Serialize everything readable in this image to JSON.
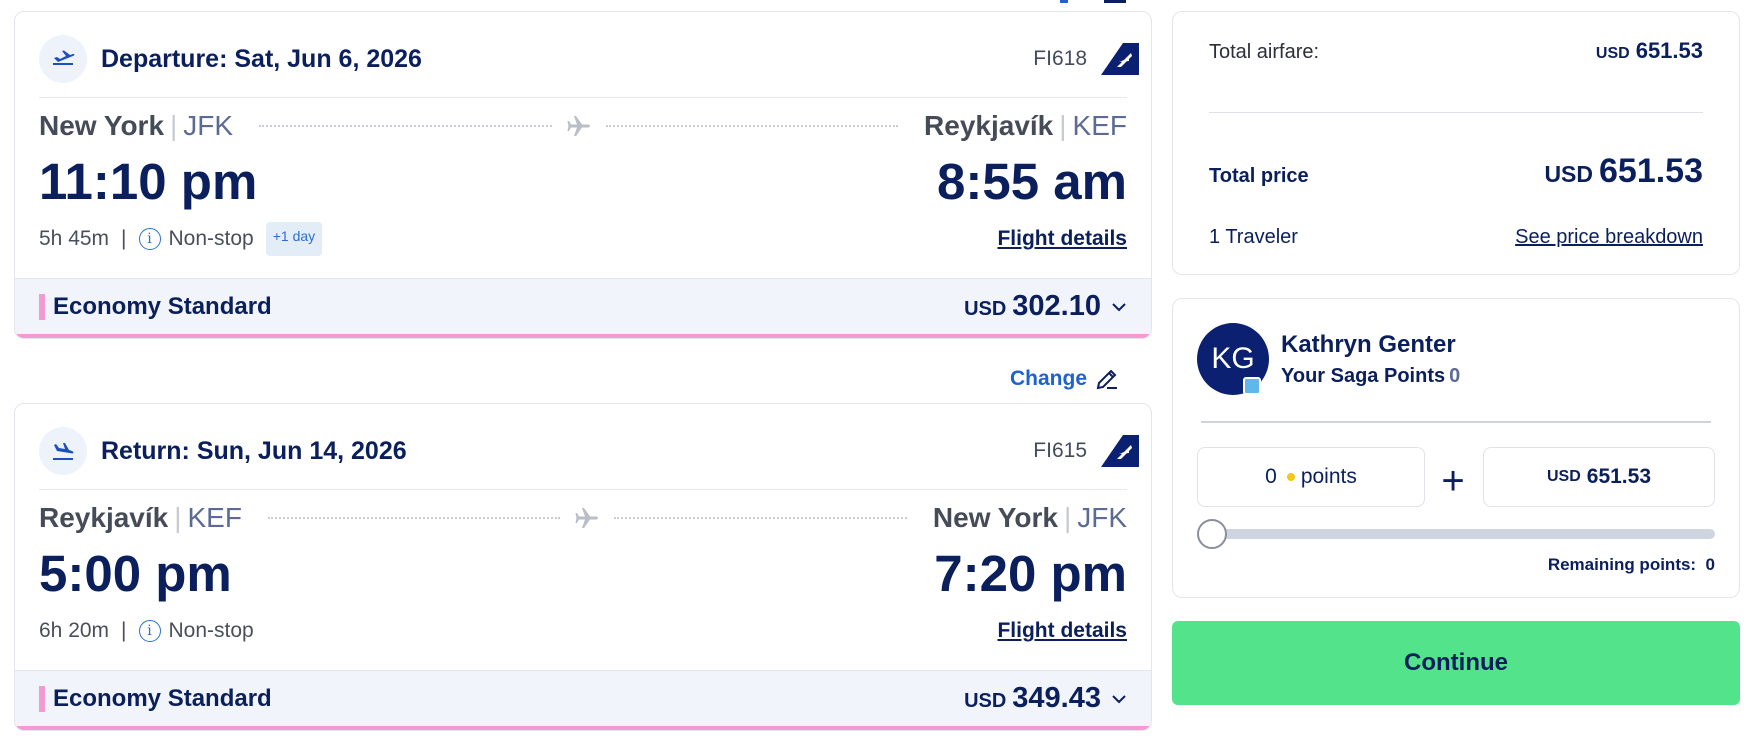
{
  "departure": {
    "title": "Departure: Sat, Jun 6, 2026",
    "flight_number": "FI618",
    "from_city": "New York",
    "from_code": "JFK",
    "to_city": "Reykjavík",
    "to_code": "KEF",
    "depart_time": "11:10 pm",
    "arrive_time": "8:55 am",
    "duration": "5h 45m",
    "stops": "Non-stop",
    "day_offset": "+1 day",
    "details_link": "Flight details",
    "fare_name": "Economy Standard",
    "fare_currency": "USD",
    "fare_amount": "302.10"
  },
  "change_label": "Change",
  "return": {
    "title": "Return: Sun, Jun 14, 2026",
    "flight_number": "FI615",
    "from_city": "Reykjavík",
    "from_code": "KEF",
    "to_city": "New York",
    "to_code": "JFK",
    "depart_time": "5:00 pm",
    "arrive_time": "7:20 pm",
    "duration": "6h 20m",
    "stops": "Non-stop",
    "details_link": "Flight details",
    "fare_name": "Economy Standard",
    "fare_currency": "USD",
    "fare_amount": "349.43"
  },
  "summary": {
    "airfare_label": "Total airfare:",
    "airfare_currency": "USD",
    "airfare_amount": "651.53",
    "total_label": "Total price",
    "total_currency": "USD",
    "total_amount": "651.53",
    "travelers": "1 Traveler",
    "breakdown_link": "See price breakdown"
  },
  "points": {
    "initials": "KG",
    "name": "Kathryn Genter",
    "saga_label": "Your Saga Points",
    "saga_value": "0",
    "points_value": "0",
    "points_unit": "points",
    "plus": "+",
    "cash_currency": "USD",
    "cash_amount": "651.53",
    "slider_fraction": 0,
    "remaining": "Remaining points:  0"
  },
  "continue_label": "Continue",
  "colors": {
    "navy": "#0a1f5c",
    "accent_pink": "#f29ad2",
    "continue_green": "#52e38b",
    "link_blue": "#1d63cf"
  }
}
